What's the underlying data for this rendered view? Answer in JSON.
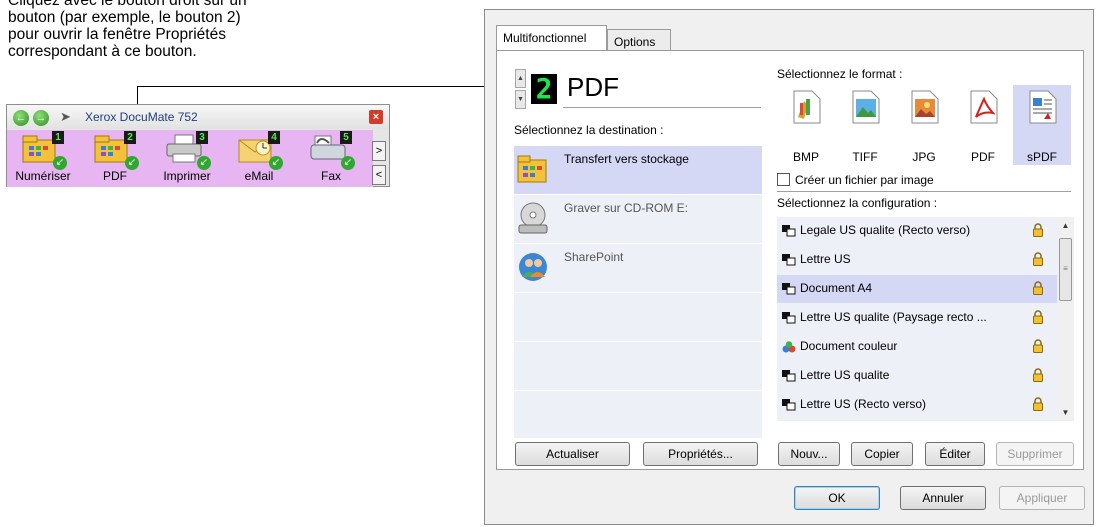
{
  "instruction": {
    "lines": [
      "Cliquez avec le bouton droit sur un",
      "bouton (par exemple, le bouton 2)",
      "pour ouvrir la fenêtre Propriétés",
      "correspondant à ce bouton."
    ]
  },
  "button_panel": {
    "title": "Xerox DocuMate 752",
    "icons": {
      "back": "back-arrow-icon",
      "forward": "forward-arrow-icon",
      "scanner": "scanner-icon",
      "close": "close-icon"
    },
    "buttons": [
      {
        "label": "Numériser",
        "number": "1",
        "icon": "folder-icon"
      },
      {
        "label": "PDF",
        "number": "2",
        "icon": "pdf-folder-icon"
      },
      {
        "label": "Imprimer",
        "number": "3",
        "icon": "printer-icon"
      },
      {
        "label": "eMail",
        "number": "4",
        "icon": "email-icon"
      },
      {
        "label": "Fax",
        "number": "5",
        "icon": "fax-icon"
      }
    ],
    "more_right": ">",
    "more_left": "<"
  },
  "dialog": {
    "tabs": [
      "Multifonctionnel",
      "Options"
    ],
    "active_tab": "Multifonctionnel",
    "button_number": "2",
    "button_name": "PDF",
    "destination_label": "Sélectionnez la destination :",
    "destinations": [
      {
        "label": "Transfert vers stockage",
        "icon": "storage-folder-icon",
        "selected": true
      },
      {
        "label": "Graver sur CD-ROM  E:",
        "icon": "cd-burner-icon",
        "selected": false
      },
      {
        "label": "SharePoint",
        "icon": "sharepoint-icon",
        "selected": false
      }
    ],
    "format_label": "Sélectionnez le format :",
    "formats": [
      {
        "label": "BMP",
        "icon": "bmp-icon",
        "selected": false
      },
      {
        "label": "TIFF",
        "icon": "tiff-icon",
        "selected": false
      },
      {
        "label": "JPG",
        "icon": "jpg-icon",
        "selected": false
      },
      {
        "label": "PDF",
        "icon": "pdf-icon",
        "selected": false
      },
      {
        "label": "sPDF",
        "icon": "spdf-icon",
        "selected": true
      }
    ],
    "one_file_per_image": {
      "label": "Créer un fichier par image",
      "checked": false
    },
    "config_label": "Sélectionnez la configuration :",
    "configurations": [
      {
        "label": "Legale US qualite (Recto verso)",
        "selected": false
      },
      {
        "label": "Lettre US",
        "selected": false
      },
      {
        "label": "Document A4",
        "selected": true
      },
      {
        "label": "Lettre US qualite (Paysage recto ...",
        "selected": false
      },
      {
        "label": "Document couleur",
        "selected": false
      },
      {
        "label": "Lettre US qualite",
        "selected": false
      },
      {
        "label": "Lettre US (Recto verso)",
        "selected": false
      }
    ],
    "buttons": {
      "refresh": "Actualiser",
      "properties": "Propriétés...",
      "new": "Nouv...",
      "copy": "Copier",
      "edit": "Éditer",
      "delete": "Supprimer",
      "ok": "OK",
      "cancel": "Annuler",
      "apply": "Appliquer"
    }
  }
}
